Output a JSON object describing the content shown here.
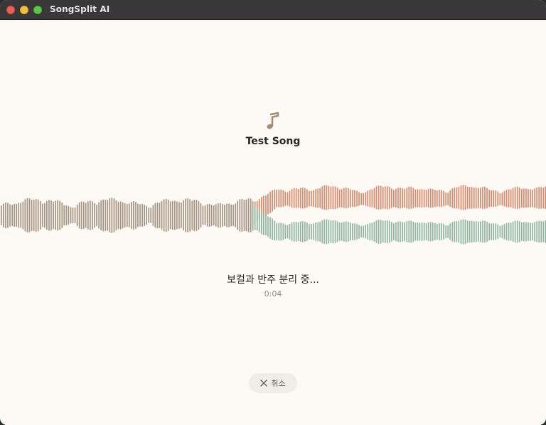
{
  "window": {
    "title": "SongSplit AI"
  },
  "song": {
    "title": "Test Song",
    "icon": "music-note-icon"
  },
  "progress": {
    "status": "보컬과 반주 분리 중...",
    "elapsed": "0:04"
  },
  "actions": {
    "cancel_label": "취소",
    "cancel_icon": "close-icon"
  },
  "colors": {
    "mixed": "#a49381",
    "vocals": "#d88a6e",
    "accompaniment": "#8fb5a0",
    "background": "#fdfaf6"
  }
}
